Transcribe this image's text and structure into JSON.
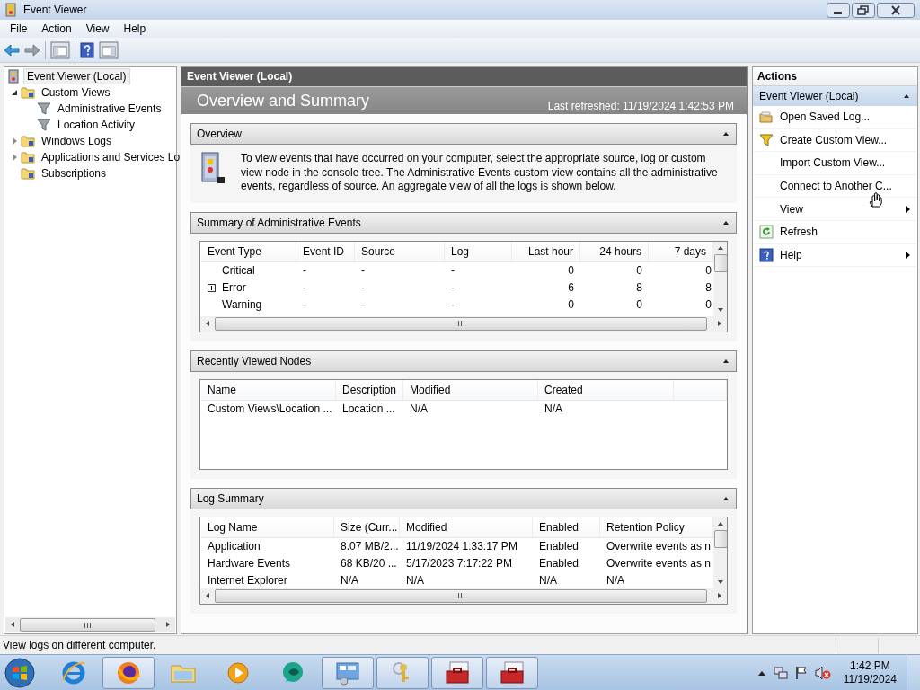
{
  "window": {
    "title": "Event Viewer"
  },
  "menu": [
    "File",
    "Action",
    "View",
    "Help"
  ],
  "tree": [
    {
      "label": "Event Viewer (Local)",
      "selected": true,
      "children": [
        {
          "label": "Custom Views",
          "selected": false,
          "expanded": true,
          "children": [
            {
              "label": "Administrative Events",
              "selected": false
            },
            {
              "label": "Location Activity",
              "selected": false
            }
          ]
        },
        {
          "label": "Windows Logs",
          "selected": false,
          "expanded": false
        },
        {
          "label": "Applications and Services Lo",
          "selected": false,
          "expanded": false
        },
        {
          "label": "Subscriptions",
          "selected": false
        }
      ]
    }
  ],
  "center": {
    "header": "Event Viewer (Local)",
    "title": "Overview and Summary",
    "last_refreshed": "Last refreshed: 11/19/2024 1:42:53 PM",
    "sections": [
      {
        "kind": "text",
        "title": "Overview",
        "expanded": true,
        "text": "To view events that have occurred on your computer, select the appropriate source, log or custom view node in the console tree. The Administrative Events custom view contains all the administrative events, regardless of source. An aggregate view of all the logs is shown below."
      },
      {
        "kind": "table",
        "title": "Summary of Administrative Events",
        "expanded": true,
        "columns": [
          "Event Type",
          "Event ID",
          "Source",
          "Log",
          "Last hour",
          "24 hours",
          "7 days"
        ],
        "rows": [
          {
            "expandable": false,
            "cells": [
              "Critical",
              "-",
              "-",
              "-",
              "0",
              "0",
              "0"
            ]
          },
          {
            "expandable": true,
            "cells": [
              "Error",
              "-",
              "-",
              "-",
              "6",
              "8",
              "8"
            ]
          },
          {
            "expandable": false,
            "cells": [
              "Warning",
              "-",
              "-",
              "-",
              "0",
              "0",
              "0"
            ]
          }
        ]
      },
      {
        "kind": "table",
        "title": "Recently Viewed Nodes",
        "expanded": true,
        "columns": [
          "Name",
          "Description",
          "Modified",
          "Created"
        ],
        "rows": [
          {
            "cells": [
              "Custom Views\\Location ...",
              "Location ...",
              "N/A",
              "N/A"
            ]
          }
        ]
      },
      {
        "kind": "table",
        "title": "Log Summary",
        "expanded": true,
        "columns": [
          "Log Name",
          "Size (Curr...",
          "Modified",
          "Enabled",
          "Retention Policy"
        ],
        "rows": [
          {
            "cells": [
              "Application",
              "8.07 MB/2...",
              "11/19/2024 1:33:17 PM",
              "Enabled",
              "Overwrite events as n"
            ]
          },
          {
            "cells": [
              "Hardware Events",
              "68 KB/20 ...",
              "5/17/2023 7:17:22 PM",
              "Enabled",
              "Overwrite events as n"
            ]
          },
          {
            "cells": [
              "Internet Explorer",
              "N/A",
              "N/A",
              "N/A",
              "N/A"
            ]
          }
        ]
      }
    ]
  },
  "actions": {
    "title": "Actions",
    "group": "Event Viewer (Local)",
    "expanded": true,
    "items": [
      {
        "label": "Open Saved Log...",
        "submenu": false
      },
      {
        "label": "Create Custom View...",
        "submenu": false
      },
      {
        "label": "Import Custom View...",
        "submenu": false
      },
      {
        "label": "Connect to Another C...",
        "submenu": false
      },
      {
        "label": "View",
        "submenu": true
      },
      {
        "label": "Refresh",
        "submenu": false
      },
      {
        "label": "Help",
        "submenu": true
      }
    ]
  },
  "status_bar": "View logs on different computer.",
  "taskbar": {
    "apps": [
      {
        "open": false
      },
      {
        "open": true
      },
      {
        "open": false
      },
      {
        "open": false
      },
      {
        "open": false
      },
      {
        "open": true
      },
      {
        "open": true
      },
      {
        "open": true
      },
      {
        "open": true
      }
    ],
    "time": "1:42 PM",
    "date": "11/19/2024"
  }
}
